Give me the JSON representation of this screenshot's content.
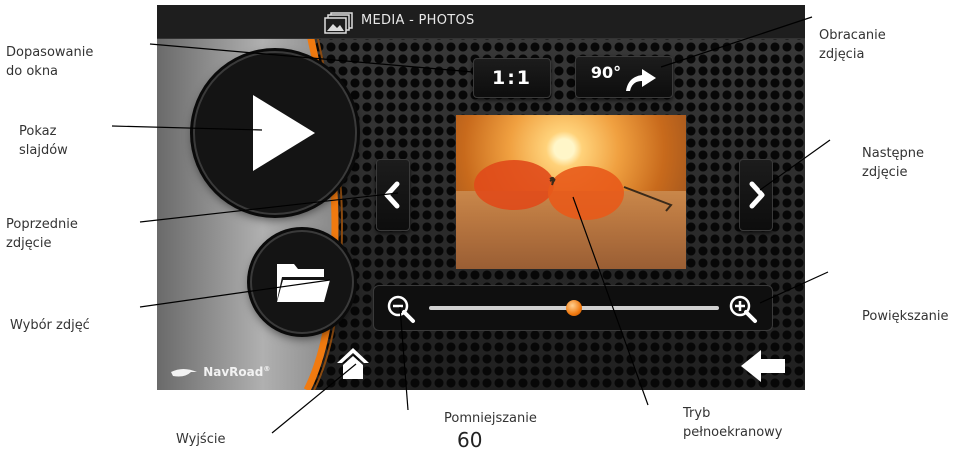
{
  "screen": {
    "title": "MEDIA - PHOTOS",
    "ratio_button": "1:1",
    "rotate_button": "90°",
    "logo": "NavRoad",
    "logo_mark": "®"
  },
  "slider": {
    "zoom_level": 0.5
  },
  "callouts": {
    "fit_window": "Dopasowanie\ndo okna",
    "slideshow": "Pokaz\nslajdów",
    "previous_photo": "Poprzednie\nzdjęcie",
    "select_photos": "Wybór zdjęć",
    "exit": "Wyjście",
    "zoom_out": "Pomniejszanie",
    "fullscreen": "Tryb\npełnoekranowy",
    "zoom_in": "Powiększanie",
    "next_photo": "Następne\nzdjęcie",
    "rotate_photo": "Obracanie\nzdjęcia"
  },
  "page_number": "60",
  "colors": {
    "accent": "#f07a10",
    "screen_bg": "#1f1f1f",
    "panel": "#a0a0a0"
  },
  "icons": [
    "photos-icon",
    "play-icon",
    "folder-icon",
    "chevron-left-icon",
    "chevron-right-icon",
    "rotate-arrow-icon",
    "zoom-out-icon",
    "zoom-in-icon",
    "home-icon",
    "back-arrow-icon"
  ]
}
